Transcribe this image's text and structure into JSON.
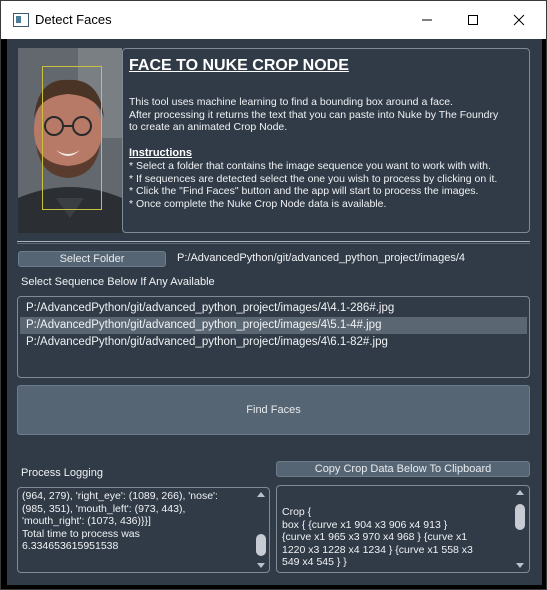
{
  "window": {
    "title": "Detect Faces",
    "icon": "app-window-icon"
  },
  "info": {
    "title": "FACE TO NUKE CROP NODE",
    "body": "This tool uses machine learning to find a bounding box around a face.\nAfter processing it returns the text that you can paste into Nuke by The Foundry\nto create an animated Crop Node.",
    "instructions_heading": "Instructions",
    "instructions": [
      "* Select a folder that contains the image sequence you want to work with with.",
      "* If sequences are detected select the one you wish to process by clicking on it.",
      "* Click the \"Find Faces\" button and the app will start to process the images.",
      "* Once complete the Nuke Crop Node data is available."
    ]
  },
  "folder": {
    "button_label": "Select Folder",
    "path": "P:/AdvancedPython/git/advanced_python_project/images/4"
  },
  "sequences": {
    "label": "Select Sequence Below If Any Available",
    "items": [
      "P:/AdvancedPython/git/advanced_python_project/images/4\\4.1-286#.jpg",
      "P:/AdvancedPython/git/advanced_python_project/images/4\\5.1-4#.jpg",
      "P:/AdvancedPython/git/advanced_python_project/images/4\\6.1-82#.jpg"
    ],
    "selected_index": 1
  },
  "find_faces": {
    "button_label": "Find Faces"
  },
  "logging": {
    "label": "Process Logging",
    "text": "(964, 279), 'right_eye': (1089, 266), 'nose':\n(985, 351), 'mouth_left': (973, 443),\n'mouth_right': (1073, 436)}}]\nTotal time to process was\n6.334653615951538"
  },
  "crop": {
    "copy_button_label": "Copy Crop Data Below To Clipboard",
    "text": "Crop {\n   box { {curve  x1 904  x3 906  x4 913  }\n{curve  x1 965  x3 970  x4 968  } {curve  x1\n1220  x3 1228  x4 1234  } {curve  x1 558  x3\n549  x4 545  } }"
  },
  "colors": {
    "background": "#303b47",
    "border": "#7f8a95",
    "button": "#566574",
    "selected_row": "#5a6672",
    "bbox": "#c9c23a"
  }
}
